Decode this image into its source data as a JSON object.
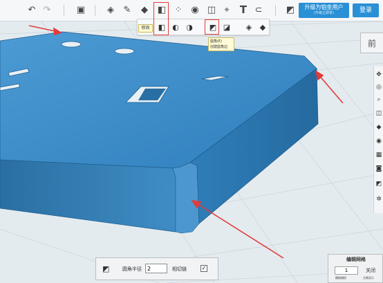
{
  "toolbar": {
    "upgrade_line1": "升级为铂金用户",
    "upgrade_line2": "(升级立即享)",
    "login_label": "登录",
    "text_tool_glyph": "T"
  },
  "submenu": {
    "tooltip_modify": "修改",
    "tooltip_fillet_title": "圆角(E)",
    "tooltip_fillet_desc": "创建圆角边"
  },
  "navcube": {
    "face_label": "前"
  },
  "bottom_panel": {
    "radius_label": "圆角半径",
    "radius_value": "2",
    "tangent_label": "相切链",
    "tangent_checked": "✓"
  },
  "grid_panel": {
    "title": "编辑网格",
    "value": "1",
    "toggle_label": "关闭",
    "caption_left": "栅格捕捉",
    "caption_right": "方格显示"
  },
  "icons": [
    "undo-icon",
    "redo-icon",
    "new-shape-icon",
    "sketch-icon",
    "primitive-icon",
    "modify-icon",
    "pattern-icon",
    "combine-icon",
    "snap-icon",
    "measure-icon",
    "text-icon",
    "magnet-icon",
    "material-icon"
  ],
  "colors": {
    "accent": "#2a90d6",
    "highlight": "#e23b3b",
    "model": "#3a86c0",
    "tooltip_bg": "#fffbd6"
  }
}
